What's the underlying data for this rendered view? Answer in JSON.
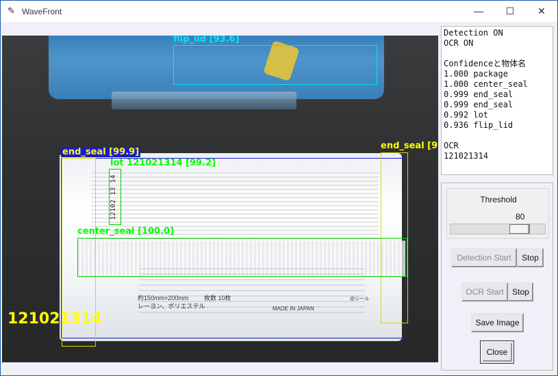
{
  "window": {
    "title": "WaveFront",
    "controls": {
      "minimize": "—",
      "maximize": "☐",
      "close": "✕"
    }
  },
  "camera": {
    "detections": [
      {
        "label": "flip_lid [93.6]",
        "color": "#00e5ff"
      },
      {
        "label": "end_seal [99.9]",
        "color": "#ffff00"
      },
      {
        "label": "end_seal [9",
        "color": "#ffff00"
      },
      {
        "label": "lot 121021314 [99.2]",
        "color": "#00ff00"
      },
      {
        "label": "center_seal [100.0]",
        "color": "#00ff00"
      },
      {
        "label": "package",
        "color": "#0000cc"
      }
    ],
    "lot_print": "12102 13 14",
    "ocr_overlay": "121021314",
    "package_print": {
      "made_in": "MADE IN JAPAN",
      "size": "約150mm×200mm",
      "count": "枚数 10枚",
      "material": "レーヨン、ポリエステル",
      "seal": "@シール"
    }
  },
  "info_panel": {
    "lines": [
      "Detection ON",
      "OCR ON",
      "",
      "Confidenceと物体名",
      "1.000 package",
      "1.000 center_seal",
      "0.999 end_seal",
      "0.999 end_seal",
      "0.992 lot",
      "0.936 flip_lid",
      "",
      "OCR",
      "121021314"
    ]
  },
  "controls": {
    "threshold_label": "Threshold",
    "threshold_value": "80",
    "threshold_fraction": 0.8,
    "detection_start": "Detection Start",
    "detection_stop": "Stop",
    "ocr_start": "OCR Start",
    "ocr_stop": "Stop",
    "save_image": "Save Image",
    "close": "Close"
  }
}
